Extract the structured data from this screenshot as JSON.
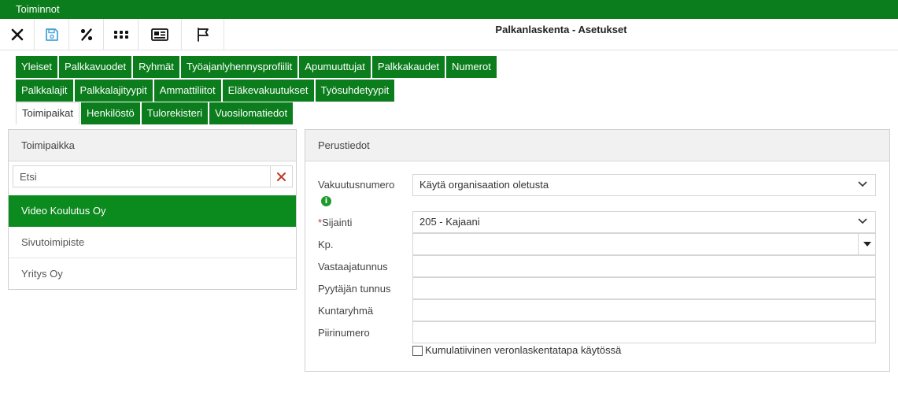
{
  "app": {
    "menu_title": "Toiminnot",
    "page_title": "Palkanlaskenta - Asetukset"
  },
  "toolbar": {
    "icons": [
      "close-icon",
      "save-icon",
      "percent-icon",
      "grid-icon",
      "id-card-icon",
      "flag-icon"
    ]
  },
  "tabs": {
    "row1": [
      "Yleiset",
      "Palkkavuodet",
      "Ryhmät",
      "Työajanlyhennysprofiilit",
      "Apumuuttujat",
      "Palkkakaudet",
      "Numerot"
    ],
    "row2": [
      "Palkkalajit",
      "Palkkalajityypit",
      "Ammattiliitot",
      "Eläkevakuutukset",
      "Työsuhdetyypit"
    ],
    "row3": [
      "Toimipaikat",
      "Henkilöstö",
      "Tulorekisteri",
      "Vuosilomatiedot"
    ],
    "active": "Toimipaikat"
  },
  "left_panel": {
    "header": "Toimipaikka",
    "search": {
      "placeholder": "Etsi",
      "value": ""
    },
    "items": [
      "Video Koulutus Oy",
      "Sivutoimipiste",
      "Yritys Oy"
    ],
    "selected": "Video Koulutus Oy"
  },
  "right_panel": {
    "header": "Perustiedot",
    "fields": {
      "vakuutusnumero": {
        "label": "Vakuutusnumero",
        "value": "Käytä organisaation oletusta"
      },
      "sijainti": {
        "required_mark": "*",
        "label": "Sijainti",
        "value": "205 - Kajaani"
      },
      "kp": {
        "label": "Kp.",
        "value": ""
      },
      "vastaajatunnus": {
        "label": "Vastaajatunnus",
        "value": ""
      },
      "pyytajan_tunnus": {
        "label": "Pyytäjän tunnus",
        "value": ""
      },
      "kuntaryhma": {
        "label": "Kuntaryhmä",
        "value": ""
      },
      "piirinumero": {
        "label": "Piirinumero",
        "value": ""
      }
    },
    "checkbox": {
      "label": "Kumulatiivinen veronlaskentatapa käytössä",
      "checked": false
    }
  },
  "colors": {
    "brand": "#0b7d1c",
    "selected": "#0b8a1e",
    "danger": "#c0392b",
    "info": "#1e9a2d"
  }
}
